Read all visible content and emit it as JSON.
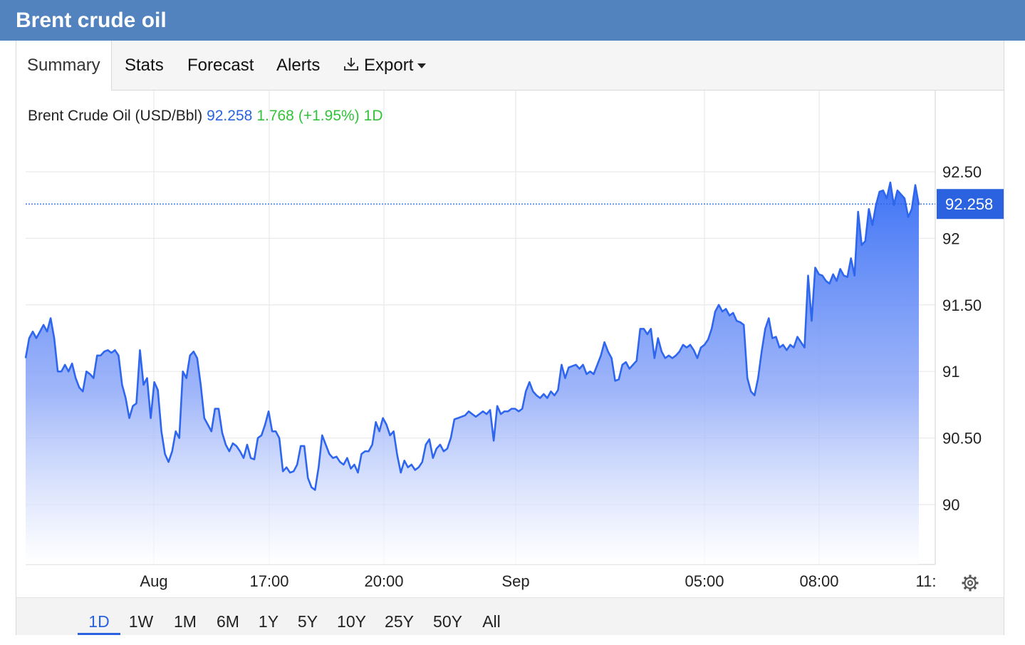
{
  "window": {
    "title": "Brent crude oil"
  },
  "tabs": [
    {
      "label": "Summary",
      "active": true
    },
    {
      "label": "Stats"
    },
    {
      "label": "Forecast"
    },
    {
      "label": "Alerts"
    },
    {
      "label": "Export",
      "icon": "download-icon",
      "dropdown": true
    }
  ],
  "quote": {
    "name": "Brent Crude Oil (USD/Bbl)",
    "price": "92.258",
    "change": "1.768",
    "change_pct": "(+1.95%)",
    "period": "1D",
    "price_color": "#2a62e0",
    "change_color": "#33c23a"
  },
  "ranges": [
    "1D",
    "1W",
    "1M",
    "6M",
    "1Y",
    "5Y",
    "10Y",
    "25Y",
    "50Y",
    "All"
  ],
  "active_range": "1D",
  "settings_icon": "gear-icon",
  "colors": {
    "header": "#5283bf",
    "line": "#2f66ee",
    "accent": "#2a62e0"
  },
  "chart_data": {
    "type": "area",
    "title": "Brent Crude Oil (USD/Bbl)",
    "ylim": [
      89.55,
      92.8
    ],
    "yticks": [
      "92.50",
      "92",
      "91.50",
      "91",
      "90.50",
      "90"
    ],
    "xticks": [
      "Aug",
      "17:00",
      "20:00",
      "Sep",
      "05:00",
      "08:00",
      "11:"
    ],
    "last_value": 92.258,
    "last_label": "92.258",
    "grid": true,
    "series": [
      {
        "values": [
          91.1,
          91.25,
          91.3,
          91.25,
          91.3,
          91.35,
          91.3,
          91.4,
          91.25,
          91.0,
          91.0,
          91.05,
          91.0,
          91.06,
          90.95,
          90.88,
          90.85,
          91.0,
          90.98,
          90.95,
          91.12,
          91.12,
          91.15,
          91.16,
          91.14,
          91.16,
          91.12,
          90.9,
          90.8,
          90.65,
          90.74,
          90.76,
          91.16,
          90.9,
          90.95,
          90.65,
          90.92,
          90.86,
          90.55,
          90.38,
          90.32,
          90.4,
          90.55,
          90.5,
          91.0,
          90.95,
          91.12,
          91.15,
          91.1,
          90.9,
          90.65,
          90.6,
          90.55,
          90.72,
          90.72,
          90.54,
          90.45,
          90.4,
          90.46,
          90.44,
          90.4,
          90.35,
          90.45,
          90.35,
          90.34,
          90.5,
          90.52,
          90.6,
          90.7,
          90.55,
          90.55,
          90.5,
          90.25,
          90.28,
          90.24,
          90.25,
          90.3,
          90.44,
          90.44,
          90.2,
          90.13,
          90.11,
          90.28,
          90.52,
          90.45,
          90.38,
          90.35,
          90.36,
          90.32,
          90.3,
          90.35,
          90.27,
          90.3,
          90.24,
          90.38,
          90.4,
          90.4,
          90.45,
          90.62,
          90.55,
          90.65,
          90.6,
          90.52,
          90.55,
          90.37,
          90.24,
          90.33,
          90.28,
          90.3,
          90.26,
          90.28,
          90.32,
          90.45,
          90.49,
          90.35,
          90.42,
          90.45,
          90.4,
          90.42,
          90.5,
          90.64,
          90.65,
          90.66,
          90.67,
          90.7,
          90.68,
          90.66,
          90.68,
          90.7,
          90.68,
          90.71,
          90.48,
          90.74,
          90.68,
          90.7,
          90.7,
          90.72,
          90.72,
          90.7,
          90.72,
          90.85,
          90.92,
          90.85,
          90.82,
          90.8,
          90.83,
          90.8,
          90.85,
          90.82,
          90.86,
          91.05,
          90.95,
          91.03,
          91.04,
          91.05,
          91.02,
          91.05,
          90.98,
          91.0,
          90.98,
          91.05,
          91.12,
          91.22,
          91.15,
          91.1,
          90.93,
          90.94,
          91.05,
          91.07,
          91.02,
          91.05,
          91.08,
          91.32,
          91.32,
          91.28,
          91.32,
          91.1,
          91.25,
          91.15,
          91.1,
          91.12,
          91.1,
          91.12,
          91.15,
          91.2,
          91.18,
          91.2,
          91.16,
          91.1,
          91.18,
          91.2,
          91.24,
          91.32,
          91.45,
          91.5,
          91.45,
          91.47,
          91.42,
          91.44,
          91.38,
          91.37,
          91.35,
          90.95,
          90.85,
          90.82,
          90.95,
          91.15,
          91.32,
          91.4,
          91.25,
          91.26,
          91.18,
          91.2,
          91.16,
          91.2,
          91.18,
          91.26,
          91.22,
          91.18,
          91.72,
          91.38,
          91.78,
          91.73,
          91.72,
          91.68,
          91.66,
          91.73,
          91.68,
          91.77,
          91.72,
          91.71,
          91.85,
          91.72,
          92.2,
          91.95,
          91.98,
          92.22,
          92.1,
          92.25,
          92.35,
          92.36,
          92.3,
          92.42,
          92.25,
          92.36,
          92.33,
          92.3,
          92.16,
          92.22,
          92.4,
          92.25
        ]
      }
    ]
  }
}
